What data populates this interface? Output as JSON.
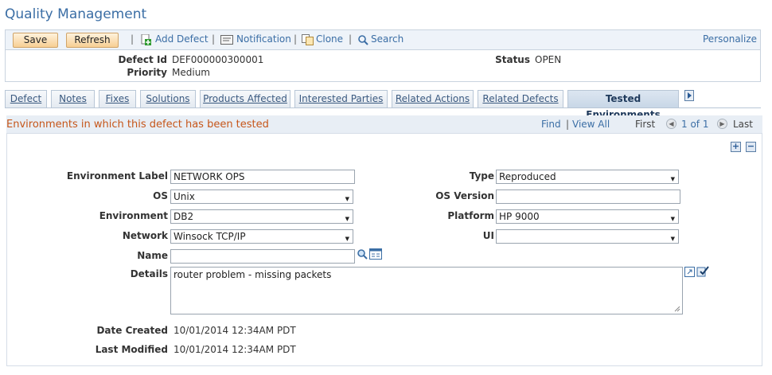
{
  "page": {
    "title": "Quality Management"
  },
  "toolbar": {
    "save": "Save",
    "refresh": "Refresh",
    "add_defect": "Add Defect",
    "notification": "Notification",
    "clone": "Clone",
    "search": "Search",
    "personalize": "Personalize",
    "separator": "|"
  },
  "header": {
    "defect_id_label": "Defect Id",
    "defect_id": "DEF000000300001",
    "status_label": "Status",
    "status": "OPEN",
    "priority_label": "Priority",
    "priority": "Medium"
  },
  "tabs": [
    {
      "label": "Defect"
    },
    {
      "label": "Notes"
    },
    {
      "label": "Fixes"
    },
    {
      "label": "Solutions"
    },
    {
      "label": "Products Affected"
    },
    {
      "label": "Interested Parties"
    },
    {
      "label": "Related Actions"
    },
    {
      "label": "Related Defects"
    },
    {
      "label": "Tested Environments"
    }
  ],
  "grid": {
    "title": "Environments in which this defect has been tested",
    "find": "Find",
    "divider": "|",
    "view_all": "View All",
    "first": "First",
    "range": "1 of 1",
    "last": "Last"
  },
  "form": {
    "environment_label_label": "Environment Label",
    "environment_label_value": "NETWORK OPS",
    "type_label": "Type",
    "type_value": "Reproduced",
    "os_label": "OS",
    "os_value": "Unix",
    "os_version_label": "OS Version",
    "os_version_value": "",
    "environment_label": "Environment",
    "environment_value": "DB2",
    "platform_label": "Platform",
    "platform_value": "HP 9000",
    "network_label": "Network",
    "network_value": "Winsock TCP/IP",
    "ui_label": "UI",
    "ui_value": "",
    "name_label": "Name",
    "name_value": "",
    "details_label": "Details",
    "details_value": "router problem - missing packets",
    "date_created_label": "Date Created",
    "date_created_value": "10/01/2014 12:34AM PDT",
    "last_modified_label": "Last Modified",
    "last_modified_value": "10/01/2014 12:34AM PDT"
  },
  "colors": {
    "accent": "#3b6ea5",
    "section_title": "#c6561a",
    "button": "#f7cf94"
  }
}
